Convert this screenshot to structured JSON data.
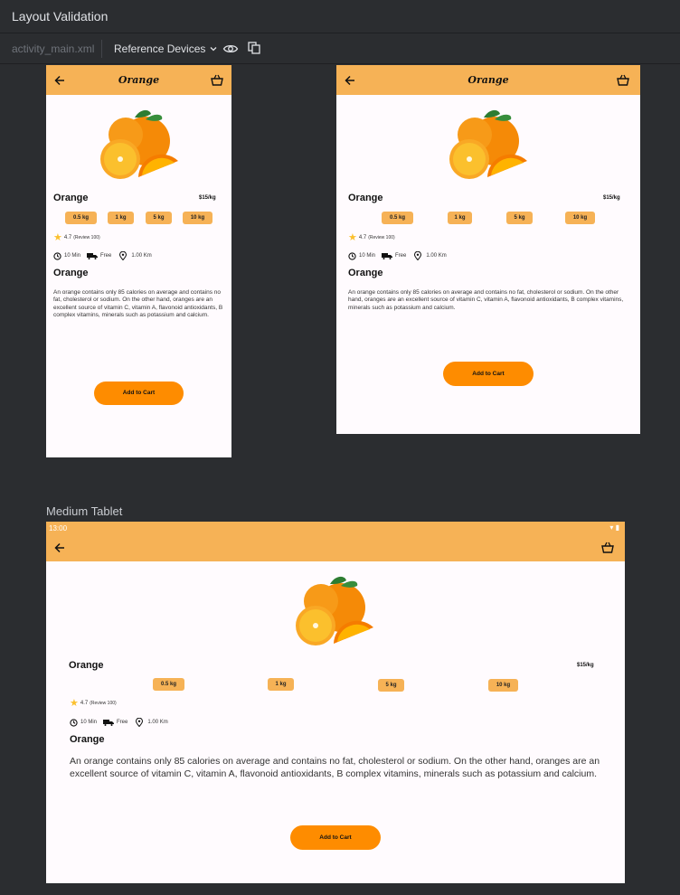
{
  "window": {
    "title": "Layout Validation"
  },
  "toolbar": {
    "file": "activity_main.xml",
    "devices_label": "Reference Devices"
  },
  "devices": {
    "tablet_label": "Medium Tablet",
    "status_time": "13:00"
  },
  "product": {
    "brand": "Orange",
    "name": "Orange",
    "price": "$15/kg",
    "weights": [
      "0.5 kg",
      "1 kg",
      "5 kg",
      "10 kg"
    ],
    "rating": "4.7",
    "reviews": "(Review 100)",
    "time": "10 Min",
    "delivery": "Free",
    "distance": "1.00 Km",
    "desc_title": "Orange",
    "description": "An orange contains only 85 calories on average and contains no fat, cholesterol or sodium. On the other hand, oranges are an excellent source of vitamin C, vitamin A, flavonoid antioxidants, B complex vitamins, minerals such as potassium and calcium.",
    "cta": "Add to Cart"
  },
  "colors": {
    "appbar": "#f6b256",
    "cta": "#fe8c00",
    "chip": "#f6b256"
  },
  "icons": [
    "arrow-back-icon",
    "basket-icon",
    "star-icon",
    "clock-icon",
    "truck-icon",
    "location-pin-icon",
    "eye-icon",
    "copy-icon",
    "chevron-down-icon"
  ]
}
